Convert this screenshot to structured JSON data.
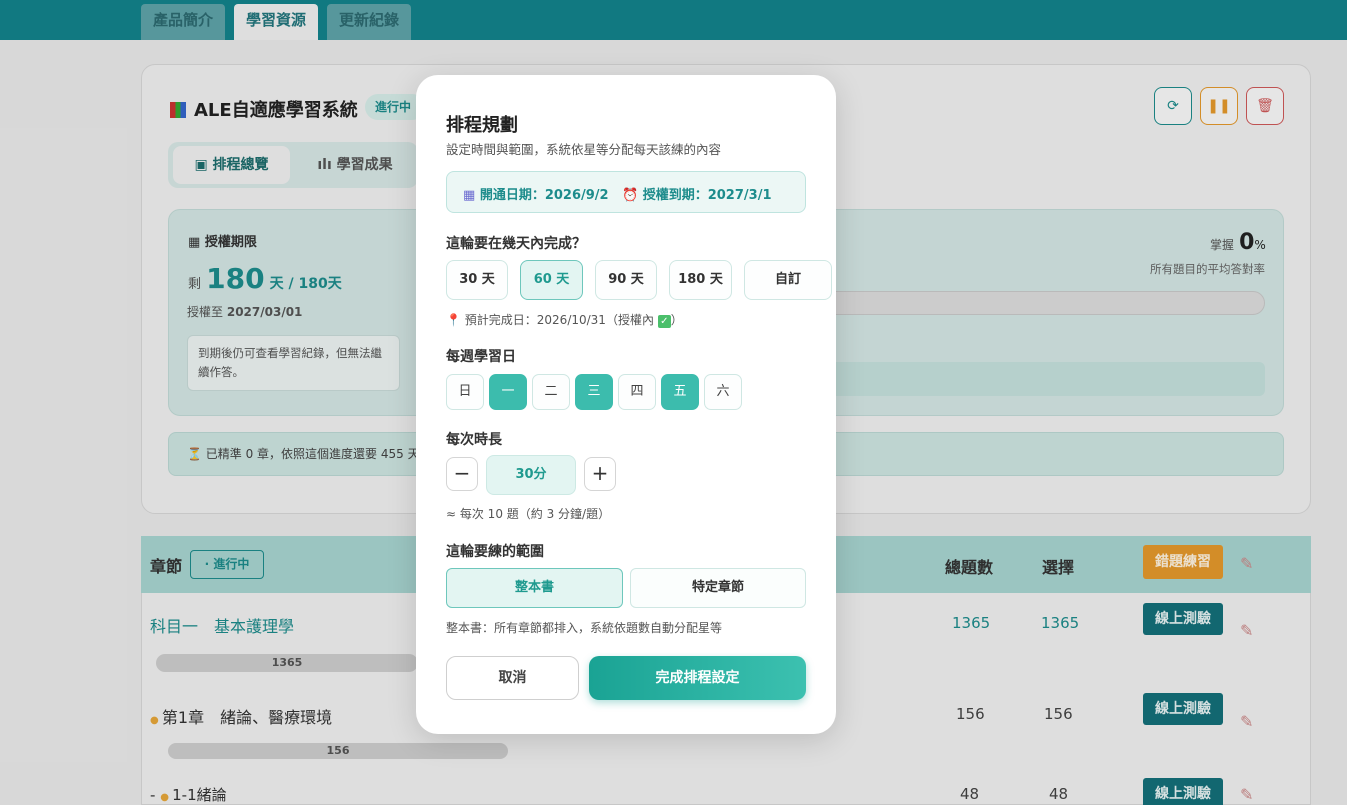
{
  "tabs": [
    "產品簡介",
    "學習資源",
    "更新紀錄"
  ],
  "background": {
    "system_title": "ALE自適應學習系統",
    "status_badge": "進行中",
    "subtabs": [
      "排程總覽",
      "學習成果"
    ],
    "license_title": "授權期限",
    "remain_prefix": "剩",
    "remain_days": "180",
    "remain_suffix": "天 / 180天",
    "license_until_label": "授權至",
    "license_until": "2027/03/01",
    "expire_note": "到期後仍可查看學習紀錄，但無法繼續作答。",
    "mastery_label": "掌握",
    "mastery_value": "0",
    "mastery_unit": "%",
    "mastery_desc": "所有題目的平均答對率",
    "progress_note": "已精準 0 章，依照這個進度還要 455 天",
    "table_header": {
      "chapter": "章節",
      "status": "進行中",
      "total": "總題數",
      "choice": "選擇",
      "wrong_btn": "錯題練習"
    },
    "rows": [
      {
        "name": "科目一　基本護理學",
        "total": "1365",
        "choice": "1365",
        "bar": "1365",
        "btn": "線上測驗"
      },
      {
        "name": "第1章　緒論、醫療環境",
        "total": "156",
        "choice": "156",
        "bar": "156",
        "btn": "線上測驗"
      },
      {
        "name": "1-1緒論",
        "total": "48",
        "choice": "48",
        "bar": "",
        "btn": "線上測驗"
      }
    ],
    "row_prefix": "-"
  },
  "modal": {
    "title": "排程規劃",
    "subtitle": "設定時間與範圍，系統依星等分配每天該練的內容",
    "open_date": "開通日期：2026/9/2",
    "expire_date": "授權到期：2027/3/1",
    "days_question": "這輪要在幾天內完成？",
    "day_options": [
      "30 天",
      "60 天",
      "90 天",
      "180 天",
      "自訂"
    ],
    "selected_day_option": "60 天",
    "finish_note": "預計完成日：2026/10/31（授權內",
    "finish_note_end": "）",
    "weekdays_label": "每週學習日",
    "weekdays": [
      "日",
      "一",
      "二",
      "三",
      "四",
      "五",
      "六"
    ],
    "selected_weekdays": [
      "一",
      "三",
      "五"
    ],
    "duration_label": "每次時長",
    "duration_value": "30分",
    "duration_note": "≈ 每次 10 題（約 3 分鐘/題）",
    "range_label": "這輪要練的範圍",
    "range_options": [
      "整本書",
      "特定章節"
    ],
    "selected_range": "整本書",
    "range_note": "整本書：所有章節都排入，系統依題數自動分配星等",
    "cancel": "取消",
    "confirm": "完成排程設定"
  },
  "colors": {
    "header": "#13848c",
    "accent": "#1d9e92",
    "selected_day": "#3cbcad",
    "wrong_btn": "#e59a2c",
    "quiz_btn": "#14707a"
  }
}
